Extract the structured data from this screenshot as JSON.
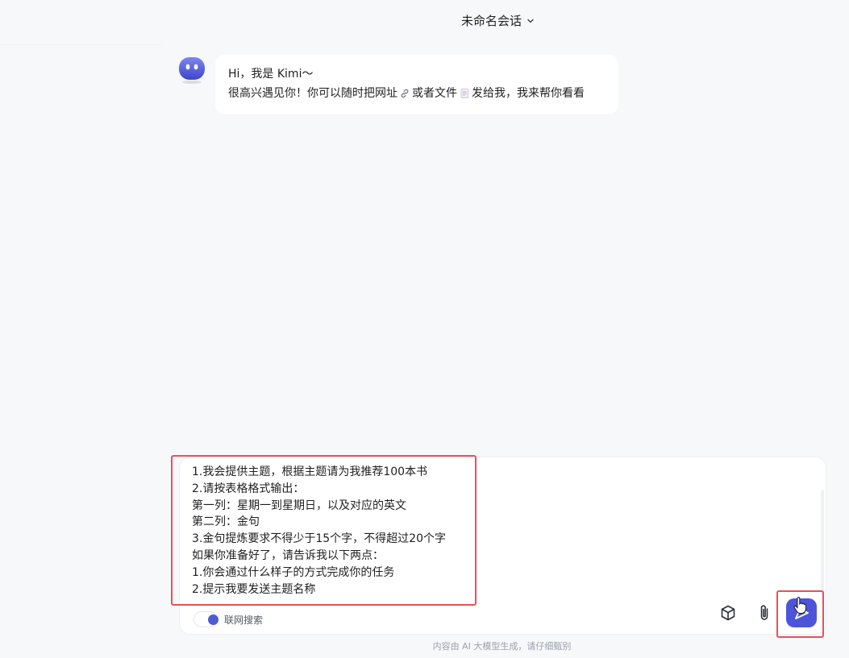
{
  "header": {
    "title": "未命名会话"
  },
  "greeting": {
    "line1": "Hi，我是 Kimi～",
    "line2_part1": "很高兴遇见你！你可以随时把网址",
    "line2_part2": "或者文件",
    "line2_part3": "发给我，我来帮你看看"
  },
  "composer": {
    "lines": [
      "1.我会提供主题，根据主题请为我推荐100本书",
      "2.请按表格格式输出：",
      "第一列：星期一到星期日，以及对应的英文",
      "第二列：金句",
      "3.金句提炼要求不得少于15个字，不得超过20个字",
      "如果你准备好了，请告诉我以下两点：",
      "1.你会通过什么样子的方式完成你的任务",
      "2.提示我要发送主题名称"
    ],
    "web_search_label": "联网搜索"
  },
  "colors": {
    "accent": "#4c55d9",
    "highlight": "#e8505b"
  },
  "footer": {
    "disclaimer": "内容由 AI 大模型生成，请仔细甄别"
  }
}
